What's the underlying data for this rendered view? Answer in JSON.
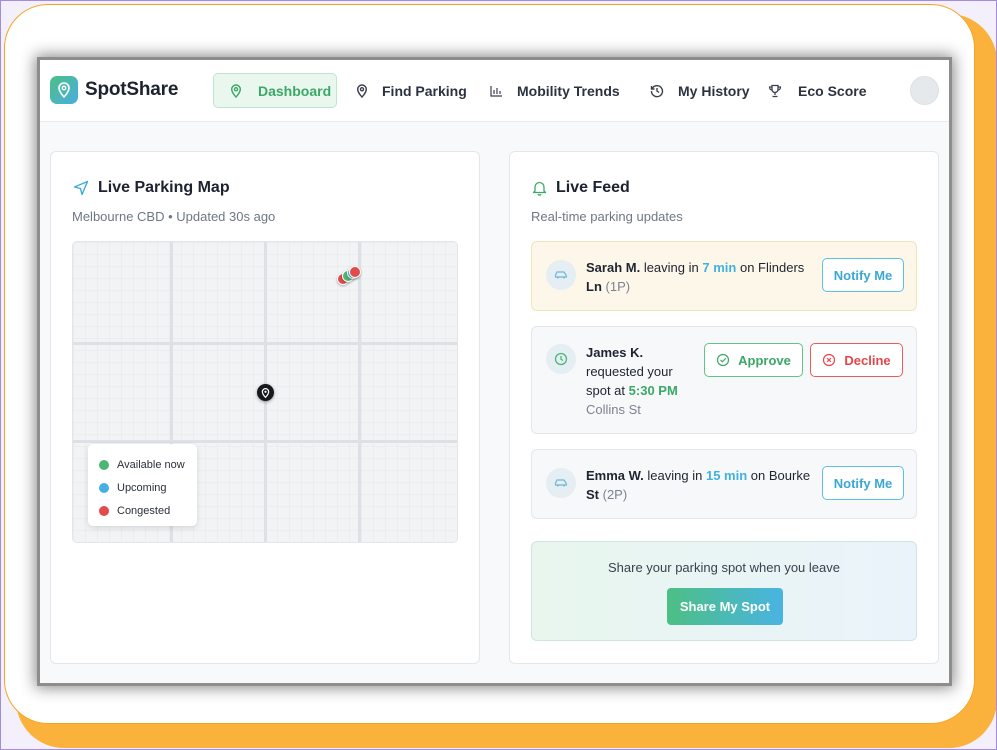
{
  "app": {
    "brand": "SpotShare"
  },
  "nav": {
    "items": [
      {
        "label": "Dashboard",
        "icon": "map-pin-icon",
        "active": true
      },
      {
        "label": "Find Parking",
        "icon": "map-pin-icon",
        "active": false
      },
      {
        "label": "Mobility Trends",
        "icon": "bar-chart-icon",
        "active": false
      },
      {
        "label": "My History",
        "icon": "history-icon",
        "active": false
      },
      {
        "label": "Eco Score",
        "icon": "trophy-icon",
        "active": false
      }
    ]
  },
  "map_panel": {
    "title": "Live Parking Map",
    "subtitle": "Melbourne CBD • Updated 30s ago",
    "legend": [
      {
        "label": "Available now",
        "color": "#4cb774"
      },
      {
        "label": "Upcoming",
        "color": "#45aee4"
      },
      {
        "label": "Congested",
        "color": "#e14b4b"
      }
    ]
  },
  "feed_panel": {
    "title": "Live Feed",
    "subtitle": "Real-time parking updates",
    "items": [
      {
        "name": "Sarah M.",
        "pre": "leaving in",
        "time": "7 min",
        "mid": "on Flinders",
        "street_tail": "Ln",
        "zone": "(1P)",
        "button": "Notify Me"
      },
      {
        "name": "James K.",
        "line2": "requested your",
        "line3_pre": "spot at",
        "time": "5:30 PM",
        "street": "Collins St",
        "approve": "Approve",
        "decline": "Decline"
      },
      {
        "name": "Emma W.",
        "pre": "leaving in",
        "time": "15 min",
        "mid": "on Bourke",
        "street_tail": "St",
        "zone": "(2P)",
        "button": "Notify Me"
      }
    ],
    "share": {
      "text": "Share your parking spot when you leave",
      "button": "Share My Spot"
    }
  },
  "colors": {
    "accent_green": "#3aa866",
    "accent_blue": "#3fb3e0",
    "danger": "#e04848",
    "frame_orange": "#fbb23c"
  }
}
